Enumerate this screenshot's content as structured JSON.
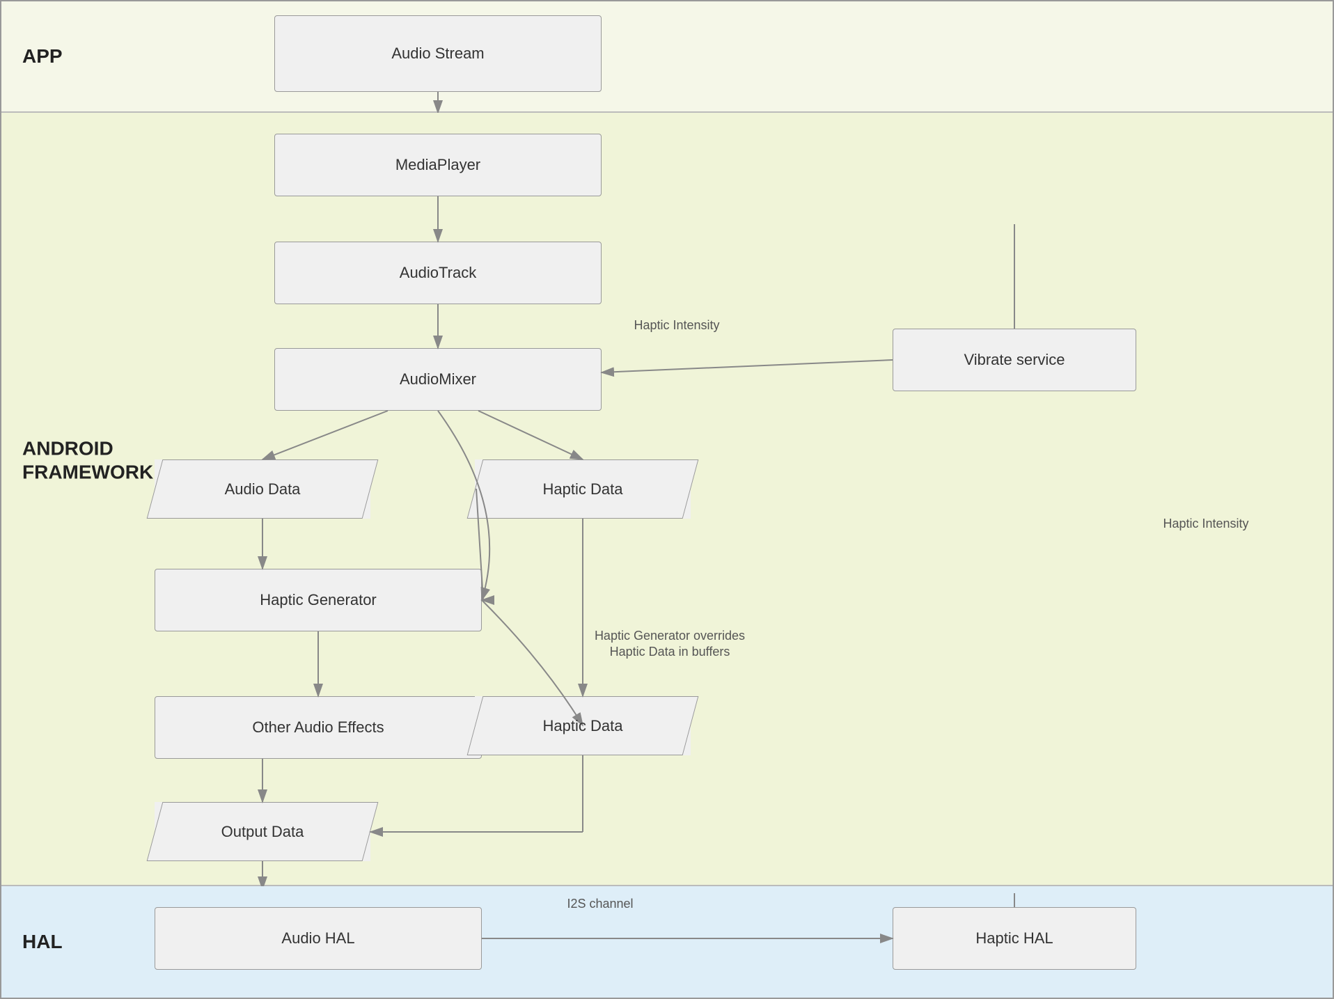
{
  "sections": {
    "app": {
      "label": "APP"
    },
    "framework": {
      "label": "ANDROID\nFRAMEWORK"
    },
    "hal": {
      "label": "HAL"
    }
  },
  "boxes": {
    "audio_stream": "Audio Stream",
    "media_player": "MediaPlayer",
    "audio_track": "AudioTrack",
    "audio_mixer": "AudioMixer",
    "vibrate_service": "Vibrate service",
    "audio_data": "Audio Data",
    "haptic_data_1": "Haptic Data",
    "haptic_generator": "Haptic Generator",
    "other_audio_effects": "Other Audio Effects",
    "haptic_data_2": "Haptic Data",
    "output_data": "Output Data",
    "audio_hal": "Audio HAL",
    "haptic_hal": "Haptic HAL"
  },
  "labels": {
    "haptic_intensity_1": "Haptic Intensity",
    "haptic_intensity_2": "Haptic Intensity",
    "haptic_generator_overrides": "Haptic Generator overrides\nHaptic Data in buffers",
    "i2s_channel": "I2S channel"
  }
}
